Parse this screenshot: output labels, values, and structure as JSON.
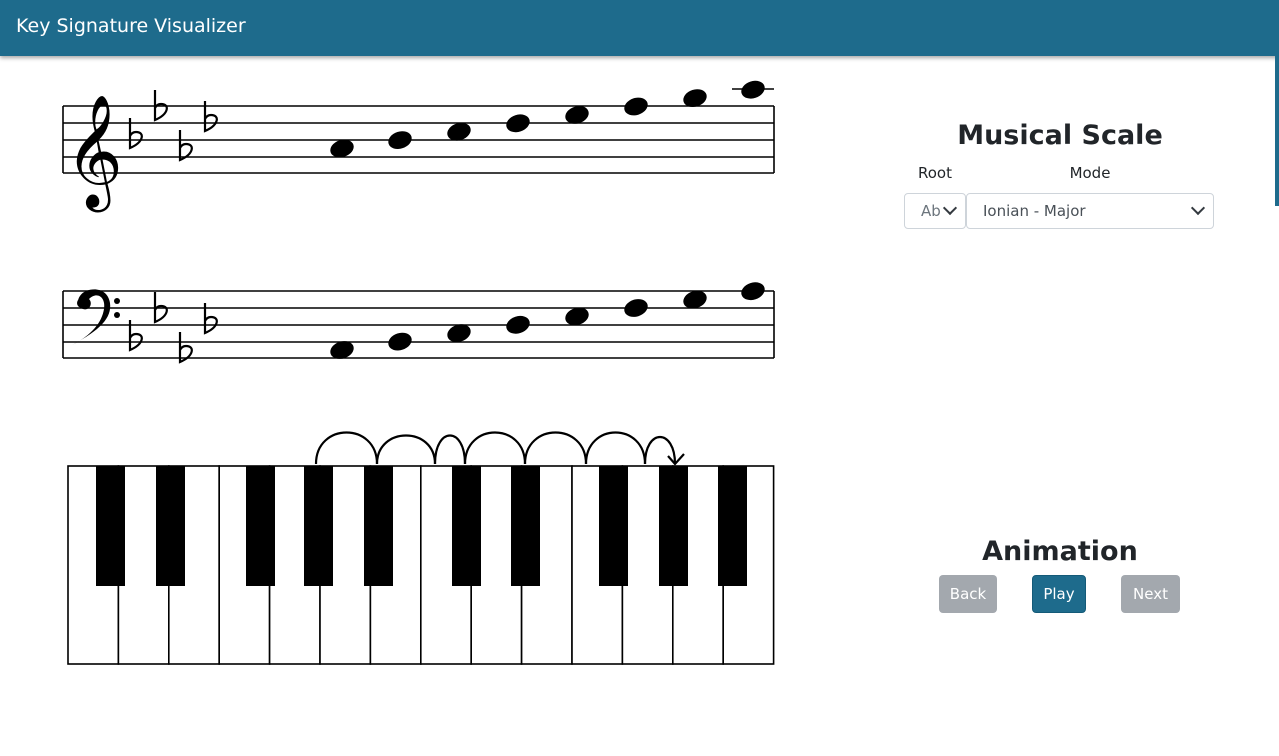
{
  "app": {
    "title": "Key Signature Visualizer"
  },
  "scale": {
    "heading": "Musical Scale",
    "root_label": "Root",
    "mode_label": "Mode",
    "root_value": "Ab",
    "mode_value": "Ionian - Major"
  },
  "animation": {
    "heading": "Animation",
    "back_label": "Back",
    "play_label": "Play",
    "next_label": "Next"
  },
  "notation": {
    "treble_flats": 4,
    "bass_flats": 4,
    "scale_notes": 8
  },
  "colors": {
    "accent": "#1e6b8c",
    "disabled": "#a3a8ae"
  }
}
